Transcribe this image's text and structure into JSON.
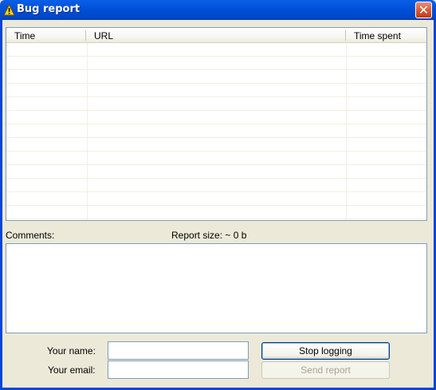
{
  "window": {
    "title": "Bug report",
    "title_icon": "warning-icon",
    "close_icon": "close-icon"
  },
  "log_table": {
    "columns": [
      "Time",
      "URL",
      "Time spent"
    ],
    "rows": []
  },
  "comments": {
    "label": "Comments:",
    "value": ""
  },
  "report_size": {
    "label": "Report size: ~ 0 b"
  },
  "form": {
    "name_label": "Your name:",
    "name_value": "",
    "email_label": "Your email:",
    "email_value": ""
  },
  "buttons": {
    "stop_logging": "Stop logging",
    "send_report": "Send report",
    "close_symbol": "✕"
  },
  "colors": {
    "titlebar": "#0050d8",
    "window_bg": "#ECE9D8",
    "close_button": "#d8572f",
    "input_border": "#7f9db9"
  }
}
